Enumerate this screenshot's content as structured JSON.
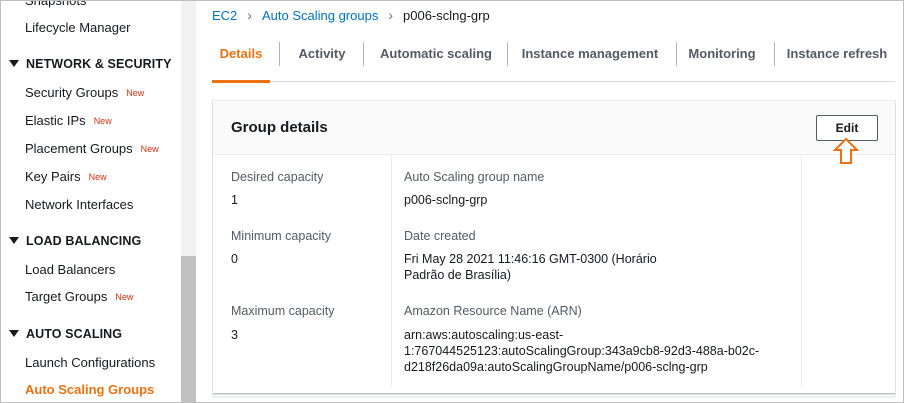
{
  "sidebar": {
    "items": [
      {
        "label": "Snapshots"
      },
      {
        "label": "Lifecycle Manager"
      },
      {
        "section": "NETWORK & SECURITY"
      },
      {
        "label": "Security Groups",
        "badge": "New"
      },
      {
        "label": "Elastic IPs",
        "badge": "New"
      },
      {
        "label": "Placement Groups",
        "badge": "New"
      },
      {
        "label": "Key Pairs",
        "badge": "New"
      },
      {
        "label": "Network Interfaces"
      },
      {
        "section": "LOAD BALANCING"
      },
      {
        "label": "Load Balancers"
      },
      {
        "label": "Target Groups",
        "badge": "New"
      },
      {
        "section": "AUTO SCALING"
      },
      {
        "label": "Launch Configurations"
      },
      {
        "label": "Auto Scaling Groups",
        "active": true
      }
    ]
  },
  "breadcrumb": {
    "ec2": "EC2",
    "asg": "Auto Scaling groups",
    "current": "p006-sclng-grp"
  },
  "tabs": [
    {
      "label": "Details",
      "active": true
    },
    {
      "label": "Activity"
    },
    {
      "label": "Automatic scaling"
    },
    {
      "label": "Instance management"
    },
    {
      "label": "Monitoring"
    },
    {
      "label": "Instance refresh"
    }
  ],
  "panel": {
    "title": "Group details",
    "edit_label": "Edit",
    "desired_capacity_label": "Desired capacity",
    "desired_capacity": "1",
    "minimum_capacity_label": "Minimum capacity",
    "minimum_capacity": "0",
    "maximum_capacity_label": "Maximum capacity",
    "maximum_capacity": "3",
    "group_name_label": "Auto Scaling group name",
    "group_name": "p006-sclng-grp",
    "date_created_label": "Date created",
    "date_created_line1": "Fri May 28 2021 11:46:16 GMT-0300 (Horário",
    "date_created_line2": "Padrão de Brasília)",
    "arn_label": "Amazon Resource Name (ARN)",
    "arn_line1": "arn:aws:autoscaling:us-east-",
    "arn_line2": "1:767044525123:autoScalingGroup:343a9cb8-92d3-488a-b02c-",
    "arn_line3": "d218f26da09a:autoScalingGroupName/p006-sclng-grp"
  },
  "colors": {
    "accent": "#ec7211",
    "link": "#0073bb",
    "new_badge": "#d13212"
  },
  "icons": {
    "pointer": "up-arrow-outline-icon"
  }
}
